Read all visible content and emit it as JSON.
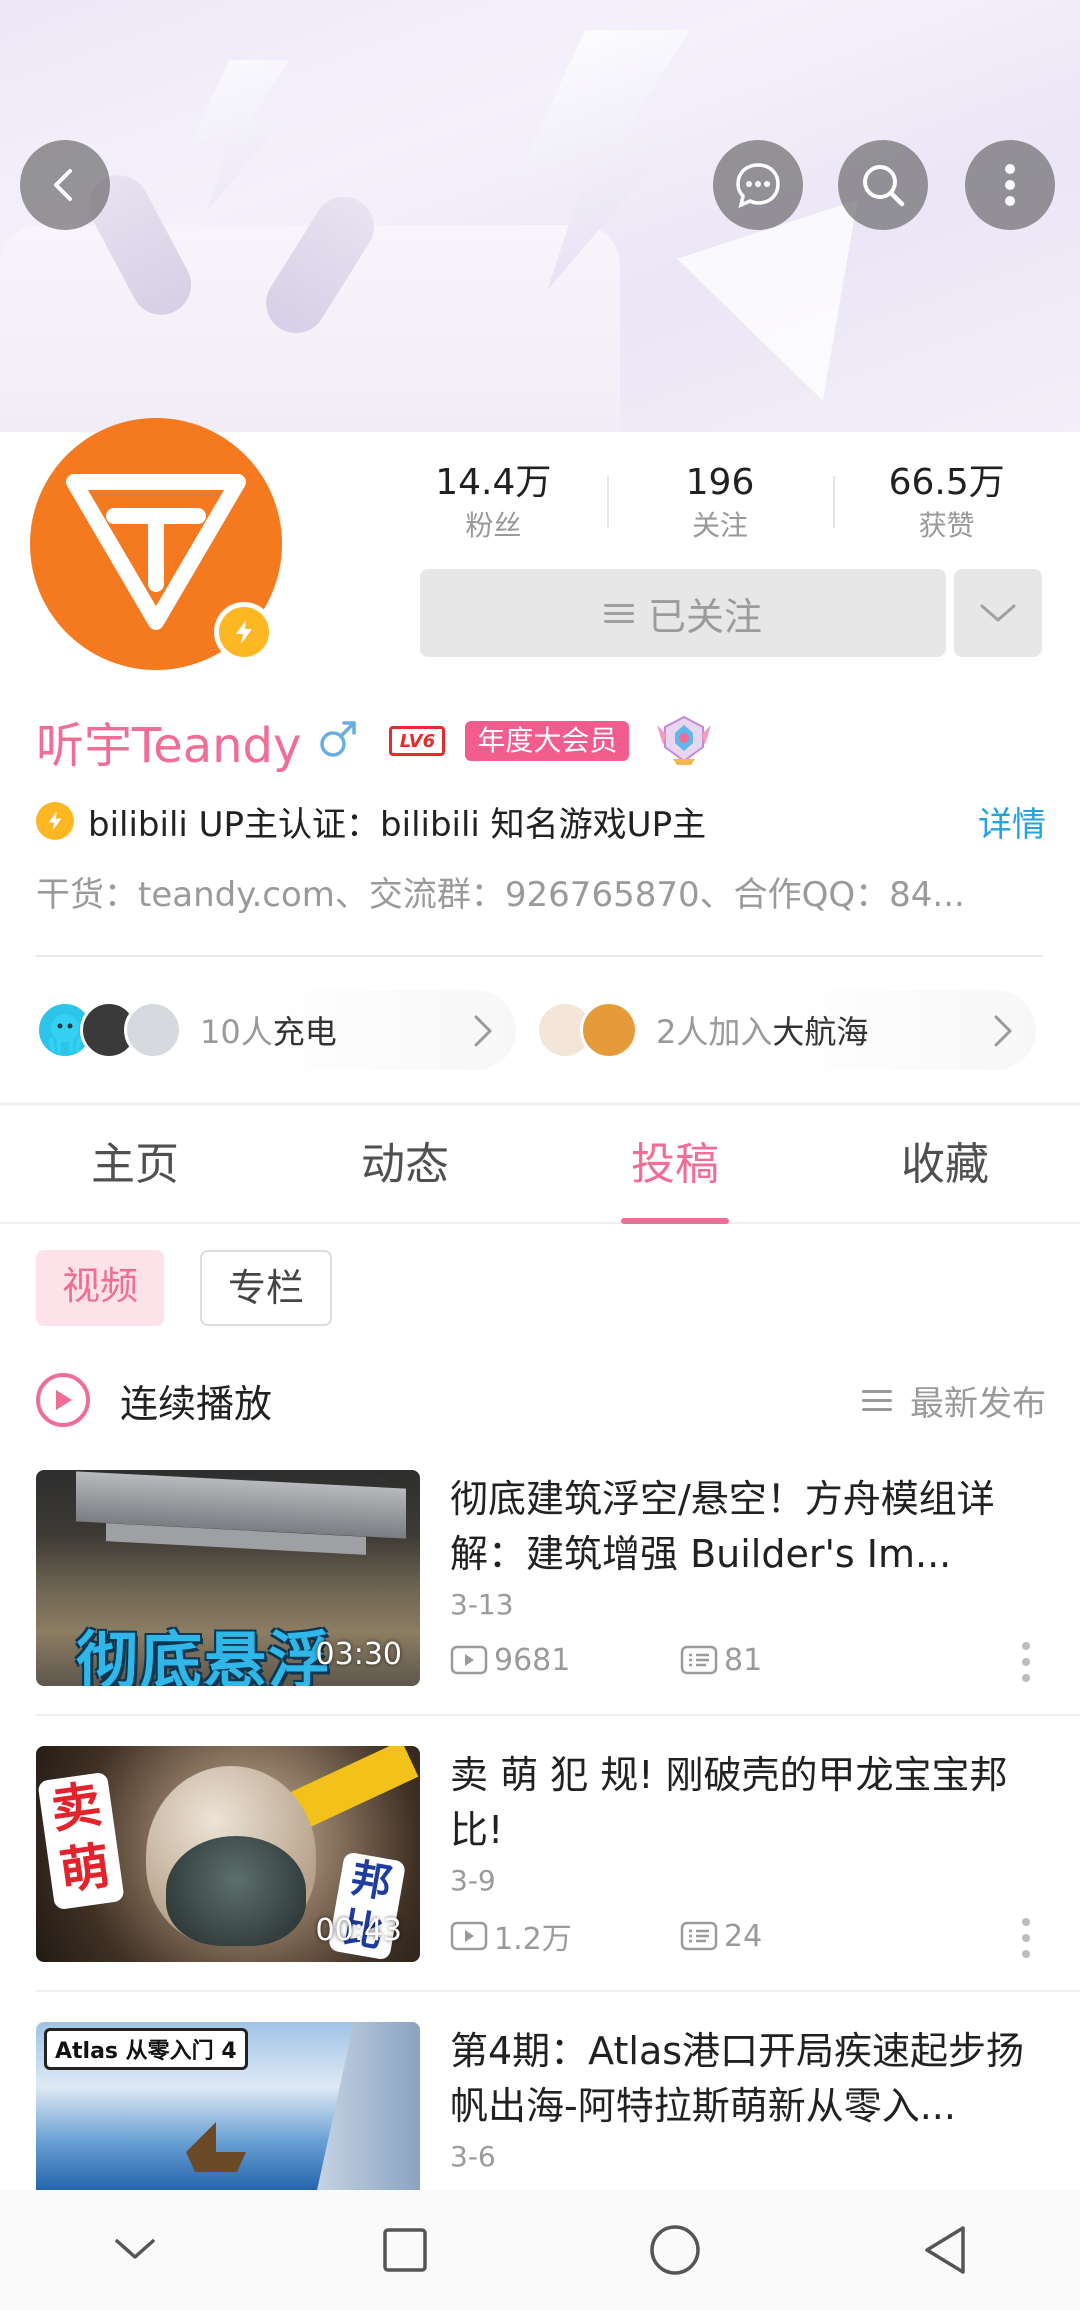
{
  "profile": {
    "stats": [
      {
        "value": "14.4万",
        "label": "粉丝"
      },
      {
        "value": "196",
        "label": "关注"
      },
      {
        "value": "66.5万",
        "label": "获赞"
      }
    ],
    "follow_label": "已关注",
    "name": "听宇Teandy",
    "level": "LV6",
    "vip_label": "年度大会员",
    "certification": "bilibili UP主认证：bilibili 知名游戏UP主",
    "cert_detail": "详情",
    "signature": "干货：teandy.com、交流群：926765870、合作QQ：84...",
    "charge": {
      "count": "10人",
      "label": "充电"
    },
    "guard": {
      "count": "2人加入",
      "label": "大航海"
    }
  },
  "tabs": [
    {
      "label": "主页",
      "active": false
    },
    {
      "label": "动态",
      "active": false
    },
    {
      "label": "投稿",
      "active": true
    },
    {
      "label": "收藏",
      "active": false
    }
  ],
  "subtabs": [
    {
      "label": "视频",
      "active": true
    },
    {
      "label": "专栏",
      "active": false
    }
  ],
  "playlist": {
    "continuous_label": "连续播放",
    "sort_label": "最新发布"
  },
  "videos": [
    {
      "title": "彻底建筑浮空/悬空！方舟模组详解：建筑增强 Builder's Im...",
      "duration": "03:30",
      "date": "3-13",
      "views": "9681",
      "comments": "81",
      "thumb_caption": "彻底悬浮"
    },
    {
      "title": "卖 萌 犯 规! 刚破壳的甲龙宝宝邦比!",
      "duration": "00:43",
      "date": "3-9",
      "views": "1.2万",
      "comments": "24",
      "thumb_caption": "卖萌",
      "thumb_caption2": "邦比"
    },
    {
      "title": "第4期：Atlas港口开局疾速起步扬帆出海-阿特拉斯萌新从零入...",
      "date": "3-6",
      "thumb_caption": "Atlas 从零入门 4"
    }
  ],
  "colors": {
    "accent_pink": "#f06d96",
    "vip_pink": "#f25d8e",
    "link_blue": "#23a3e0",
    "avatar_orange": "#f4791f",
    "verify_yellow": "#fcb723"
  },
  "icons": {
    "back": "back-arrow-icon",
    "message": "message-bubble-icon",
    "search": "search-icon",
    "more": "more-vertical-icon"
  }
}
